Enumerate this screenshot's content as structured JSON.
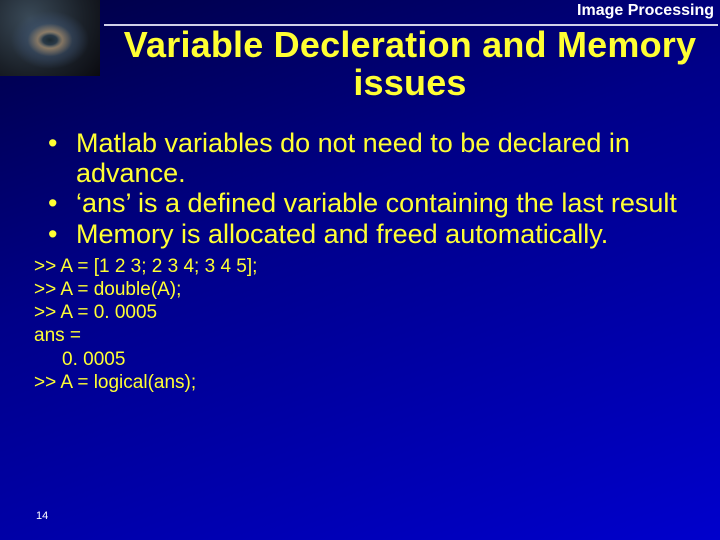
{
  "header": {
    "course": "Image Processing",
    "title": "Variable Decleration and Memory issues"
  },
  "bullets": [
    "Matlab variables do not need to be declared in advance.",
    "‘ans’ is a defined variable containing the last result",
    "Memory is allocated and freed automatically."
  ],
  "code": [
    ">> A = [1 2 3; 2 3 4; 3 4 5];",
    ">> A = double(A);",
    ">> A = 0. 0005",
    "ans =",
    "    0. 0005",
    ">> A = logical(ans);"
  ],
  "page_number": "14"
}
